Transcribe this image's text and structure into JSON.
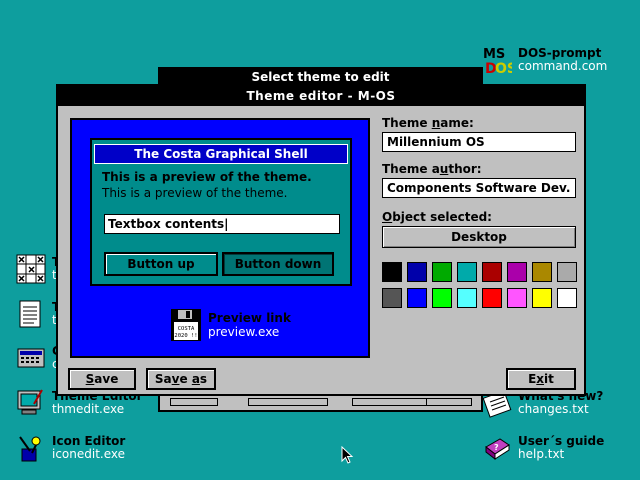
{
  "desktop": {
    "icons": [
      {
        "name": "DOS-prompt",
        "file": "command.com",
        "icon": "ms-dos-icon"
      },
      {
        "name": "What's new?",
        "file": "changes.txt",
        "icon": "notepad-icon"
      },
      {
        "name": "User´s guide",
        "file": "help.txt",
        "icon": "book-icon"
      },
      {
        "name": "Icon Editor",
        "file": "iconedit.exe",
        "icon": "paint-tools-icon"
      },
      {
        "name": "Theme Editor",
        "file": "thmedit.exe",
        "icon": "monitor-brush-icon"
      },
      {
        "name": "C",
        "file": "c",
        "icon": "calculator-icon"
      },
      {
        "name": "T",
        "file": "t",
        "icon": "document-icon"
      },
      {
        "name": "T",
        "file": "t",
        "icon": "grid-game-icon"
      }
    ]
  },
  "background_window": {
    "title": "Select theme to edit"
  },
  "editor": {
    "title": "Theme editor - M-OS",
    "preview": {
      "window_title": "The Costa Graphical Shell",
      "text_bold": "This is a preview of the theme.",
      "text_normal": "This is a preview of the theme.",
      "textbox": "Textbox contents|",
      "button_up": "Button up",
      "button_down": "Button down",
      "link_name": "Preview link",
      "link_file": "preview.exe",
      "floppy_label_1": "COSTA",
      "floppy_label_2": "2020 !!"
    },
    "theme_name_label": "Theme name:",
    "theme_name": "Millennium OS",
    "theme_author_label": "Theme author:",
    "theme_author": "Components Software Dev.",
    "object_selected_label": "Object selected:",
    "object_selected": "Desktop",
    "palette": [
      "#000000",
      "#0000aa",
      "#00aa00",
      "#00aaaa",
      "#aa0000",
      "#aa00aa",
      "#aa8800",
      "#aaaaaa",
      "#555555",
      "#0000ff",
      "#00ff00",
      "#55ffff",
      "#ff0000",
      "#ff55ff",
      "#ffff00",
      "#ffffff"
    ],
    "save_label": "Save",
    "save_as_label": "Save as",
    "exit_label": "Exit"
  }
}
